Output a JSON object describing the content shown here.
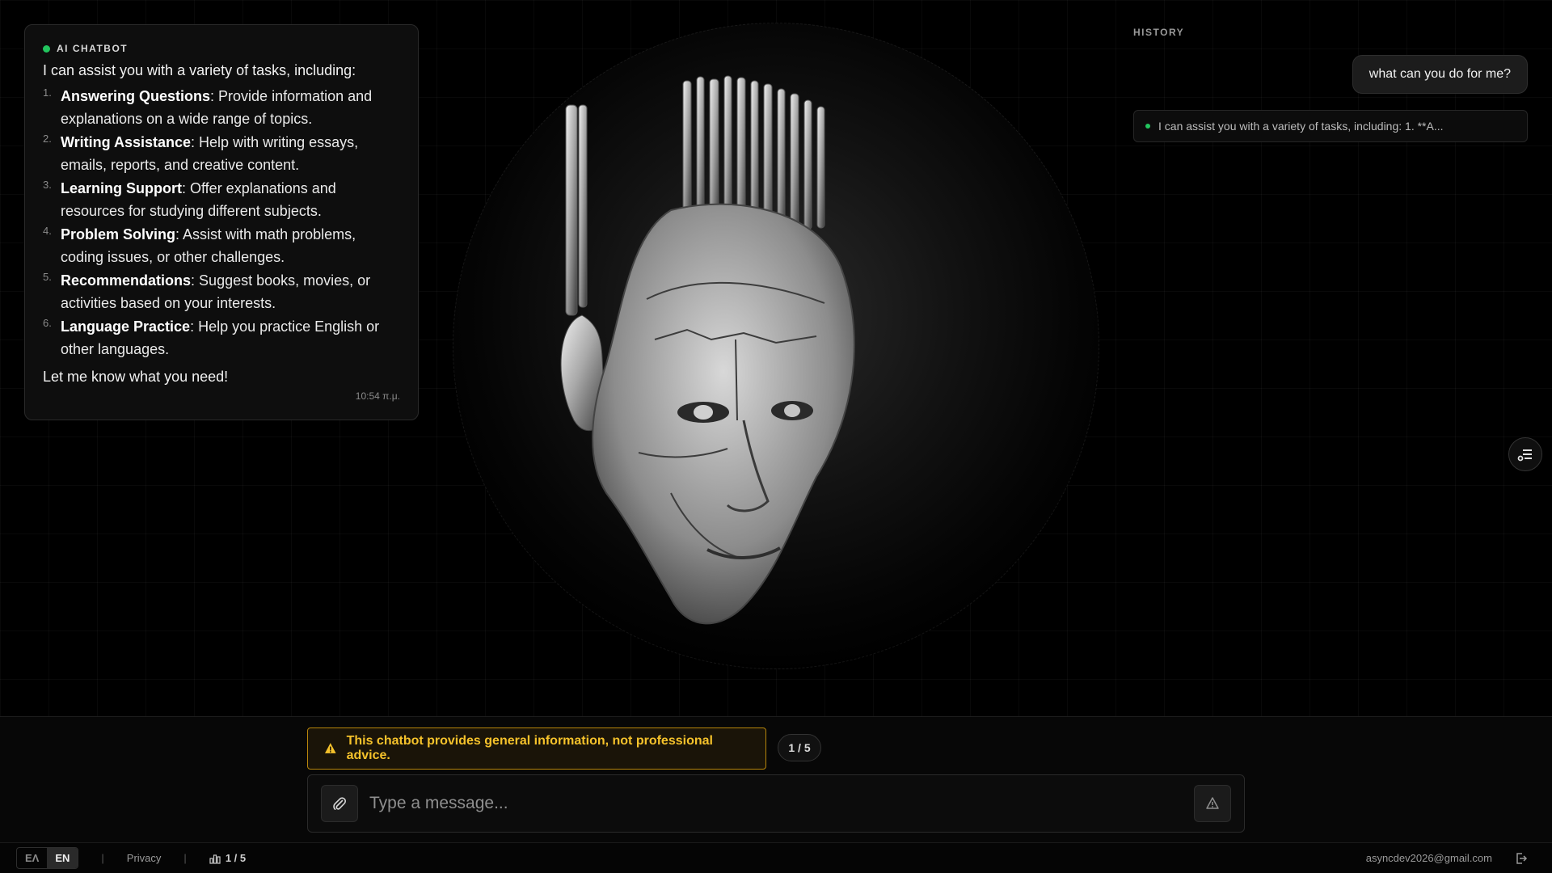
{
  "chat": {
    "bot_name": "AI CHATBOT",
    "intro": "I can assist you with a variety of tasks, including:",
    "items": [
      {
        "num": "1.",
        "title": "Answering Questions",
        "desc": ": Provide information and explanations on a wide range of topics."
      },
      {
        "num": "2.",
        "title": "Writing Assistance",
        "desc": ": Help with writing essays, emails, reports, and creative content."
      },
      {
        "num": "3.",
        "title": "Learning Support",
        "desc": ": Offer explanations and resources for studying different subjects."
      },
      {
        "num": "4.",
        "title": "Problem Solving",
        "desc": ": Assist with math problems, coding issues, or other challenges."
      },
      {
        "num": "5.",
        "title": "Recommendations",
        "desc": ": Suggest books, movies, or activities based on your interests."
      },
      {
        "num": "6.",
        "title": "Language Practice",
        "desc": ": Help you practice English or other languages."
      }
    ],
    "outro": "Let me know what you need!",
    "timestamp": "10:54 π.μ."
  },
  "history": {
    "label": "HISTORY",
    "user_message": "what can you do for me?",
    "entry_preview": "I can assist you with a variety of tasks, including: 1. **A..."
  },
  "composer": {
    "disclaimer": "This chatbot provides general information, not professional advice.",
    "page_indicator": "1 / 5",
    "placeholder": "Type a message..."
  },
  "footer": {
    "lang_el": "ΕΛ",
    "lang_en": "EN",
    "privacy": "Privacy",
    "counter": "1 / 5",
    "email": "asyncdev2026@gmail.com"
  },
  "colors": {
    "accent_green": "#22c55e",
    "warning": "#f5c22b",
    "background": "#000000"
  },
  "icons": [
    "attach-icon",
    "send-icon",
    "warning-icon",
    "sidebar-toggle-icon",
    "chart-icon",
    "logout-icon"
  ]
}
